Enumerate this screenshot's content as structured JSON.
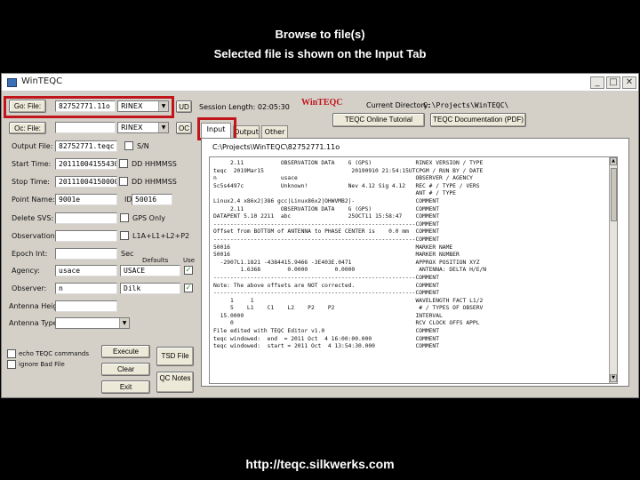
{
  "slide": {
    "caption_line1": "Browse to file(s)",
    "caption_line2": "Selected file is shown on the Input Tab",
    "footer_url": "http://teqc.silkwerks.com",
    "highlight_color": "#c0151b"
  },
  "window": {
    "title": "WinTEQC",
    "minimize": "_",
    "maximize": "□",
    "close": "✕"
  },
  "top": {
    "go_file_label": "Go: File:",
    "go_file_value": "82752771.11o",
    "go_file_format": "RINEX",
    "ud_button": "UD",
    "session_length_label": "Session Length: 02:05:30",
    "logo": "WinTEQC",
    "current_dir_label": "Current Directory:",
    "current_dir_value": "C:\\Projects\\WinTEQC\\",
    "oc_file_label": "Oc: File:",
    "oc_format": "RINEX",
    "oc_button": "OC",
    "online_tutorial": "TEQC Online Tutorial",
    "documentation": "TEQC Documentation (PDF)"
  },
  "form": {
    "output_file_label": "Output File:",
    "output_file_value": "82752771.teqc",
    "start_time_label": "Start Time:",
    "start_time_value": "20111004155430",
    "start_time_hint": "DD HHMMSS",
    "stop_time_label": "Stop Time:",
    "stop_time_value": "20111004150000",
    "stop_time_hint": "DD HHMMSS",
    "point_name_label": "Point Name:",
    "point_name_value": "9001e",
    "id_label": "ID:",
    "id_value": "50016",
    "delete_svs_label": "Delete SVS:",
    "gps_only_label": "GPS Only",
    "observations_label": "Observations:",
    "obs_hint": "L1A+L1+L2+P2",
    "epoch_int_label": "Epoch Int:",
    "sec_label": "Sec",
    "defaults_label": "Defaults",
    "use_label": "Use",
    "agency_label": "Agency:",
    "agency_value": "usace",
    "agency_default": "USACE",
    "observer_label": "Observer:",
    "observer_value": "n",
    "observer_default": "Dilk",
    "antenna_height_label": "Antenna Height:",
    "antenna_type_label": "Antenna Type",
    "echo_label": "echo TEQC commands",
    "ignore_label": "ignore Bad File",
    "execute_button": "Execute",
    "clear_button": "Clear",
    "exit_button": "Exit",
    "tsd_button": "TSD File",
    "qc_button": "QC Notes"
  },
  "tabs": [
    "Input",
    "Output",
    "Other"
  ],
  "input_panel": {
    "path": "C:\\Projects\\WinTEQC\\82752771.11o",
    "lines": [
      "     2.11           OBSERVATION DATA    G (GPS)             RINEX VERSION / TYPE",
      "teqc  2019Mar15                          20190910 21:54:15UTCPGM / RUN BY / DATE",
      "n                   usace                                   OBSERVER / AGENCY",
      "5c5s4497c           Unknown!            Nev 4.12 Sig 4.12   REC # / TYPE / VERS",
      "                                                            ANT # / TYPE",
      "Linux2.4 x86x2|386 gcc|Linux86x2|OHWVMB2|-                  COMMENT",
      "     2.11           OBSERVATION DATA    G (GPS)             COMMENT",
      "DATAPENT 5.10 2211  abc                 25OCT11 15:58:47    COMMENT",
      "------------------------------------------------------------COMMENT",
      "Offset from BOTTOM of ANTENNA to PHASE CENTER is    0.0 mm  COMMENT",
      "------------------------------------------------------------COMMENT",
      "50016                                                       MARKER NAME",
      "50016                                                       MARKER NUMBER",
      "  -2907L1.1821 -4384415.9466 -3E403E.0471                   APPROX POSITION XYZ",
      "        1.6368        0.0000        0.0000                   ANTENNA: DELTA H/E/N",
      "------------------------------------------------------------COMMENT",
      "Note: The above offsets are NOT corrected.                  COMMENT",
      "------------------------------------------------------------COMMENT",
      "     1     1                                                WAVELENGTH FACT L1/2",
      "     5    L1    C1    L2    P2    P2                         # / TYPES OF OBSERV",
      "  15.0000                                                   INTERVAL",
      "     0                                                      RCV CLOCK OFFS APPL",
      "File edited with TEQC Editor v1.0                           COMMENT",
      "teqc windowed:  end  = 2011 Oct  4 16:00:00.000             COMMENT",
      "teqc windowed:  start = 2011 Oct  4 13:54:30.000            COMMENT"
    ]
  }
}
